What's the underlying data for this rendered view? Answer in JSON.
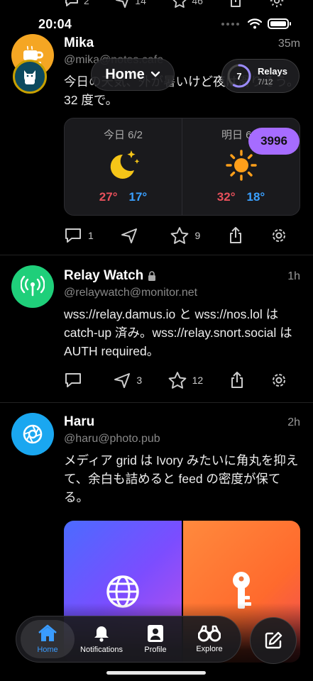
{
  "status_bar": {
    "time": "20:04"
  },
  "previous_post": {
    "reply_count": "2",
    "repost_count": "14",
    "like_count": "46"
  },
  "header": {
    "feed_title": "Home",
    "relays_label": "Relays",
    "relays_count": "7",
    "relays_ratio": "7/12",
    "relays_connected": 7,
    "relays_total": 12
  },
  "unread_badge": "3996",
  "posts": [
    {
      "name": "Mika",
      "time": "35m",
      "handle": "@mika@notes.cafe",
      "content": "今日の天気、外が暑いけど夜は滑りそう。32 度で。",
      "weather": {
        "today": {
          "label": "今日 6/2",
          "hi": "27°",
          "lo": "17°",
          "icon": "moon-stars-icon"
        },
        "tomorrow": {
          "label": "明日 6/3",
          "hi": "32°",
          "lo": "18°",
          "icon": "sun-icon"
        }
      },
      "reply_count": "1",
      "repost_count": "",
      "like_count": "9"
    },
    {
      "name": "Relay Watch",
      "locked": true,
      "time": "1h",
      "handle": "@relaywatch@monitor.net",
      "content": "wss://relay.damus.io と wss://nos.lol は catch-up 済み。wss://relay.snort.social は AUTH required。",
      "reply_count": "",
      "repost_count": "3",
      "like_count": "12"
    },
    {
      "name": "Haru",
      "time": "2h",
      "handle": "@haru@photo.pub",
      "content": "メディア grid は Ivory みたいに角丸を抑えて、余白も詰めると feed の密度が保てる。",
      "media": [
        "globe-icon",
        "key-icon"
      ]
    }
  ],
  "tab_bar": {
    "tabs": [
      {
        "label": "Home",
        "icon": "house-icon",
        "active": true
      },
      {
        "label": "Notifications",
        "icon": "bell-icon",
        "active": false
      },
      {
        "label": "Profile",
        "icon": "person-card-icon",
        "active": false
      },
      {
        "label": "Explore",
        "icon": "binoculars-icon",
        "active": false
      }
    ],
    "compose_icon": "compose-icon"
  },
  "colors": {
    "accent": "#3a9cff",
    "badge": "#a66cff",
    "hi_temp": "#e8505b",
    "lo_temp": "#3aa0ff"
  }
}
